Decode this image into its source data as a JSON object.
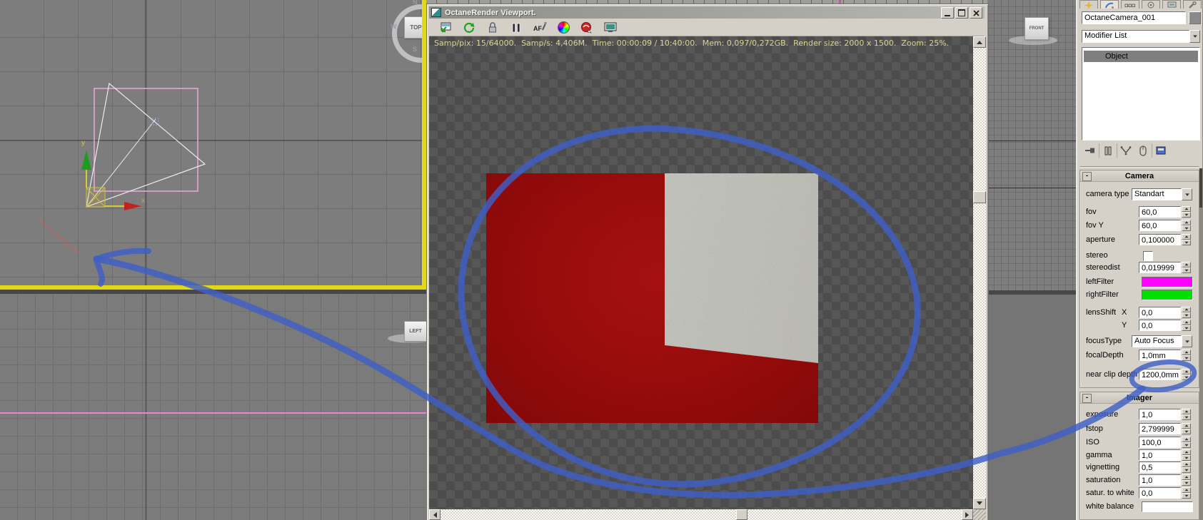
{
  "octane_window": {
    "title": "OctaneRender Viewport.",
    "window_buttons": [
      "minimize",
      "maximize",
      "close"
    ],
    "toolbar_icons": [
      "save-image",
      "restart-render",
      "lock-resolution",
      "pause-render",
      "autofocus-picker",
      "whitebalance-picker",
      "network-render",
      "fit-to-screen"
    ],
    "status_line": "Samp/pix: 15/64000.  Samp/s: 4,406M.  Time: 00:00:09 / 10:40:00.  Mem: 0,097/0,272GB.  Render size: 2000 x 1500.  Zoom: 25%."
  },
  "viewports": {
    "top_view": {
      "viewcube_label": "TOP",
      "compass": {
        "n": "N",
        "w": "W",
        "s": "S"
      },
      "axis_labels": {
        "x": "x",
        "y": "y"
      }
    },
    "left_view": {
      "viewcube_label": "LEFT"
    },
    "front_view": {
      "viewcube_label": "FRONT"
    }
  },
  "command_panel": {
    "tabs": [
      "create",
      "modify",
      "hierarchy",
      "motion",
      "display",
      "utilities"
    ],
    "active_tab": "modify",
    "object_name": "OctaneCamera_001",
    "object_color": "#8a8a8a",
    "modifier_list_label": "Modifier List",
    "modifier_stack": [
      "Object"
    ],
    "stack_tools": [
      "pin-stack",
      "show-end-result",
      "make-unique",
      "remove-modifier",
      "configure-modifier-sets"
    ],
    "rollouts": [
      {
        "title": "Camera",
        "collapse_glyph": "-",
        "rows": [
          {
            "label": "camera type",
            "type": "dropdown",
            "value": "Standart"
          },
          {
            "label": "fov",
            "type": "spinner",
            "value": "60,0"
          },
          {
            "label": "fov Y",
            "type": "spinner",
            "value": "60,0"
          },
          {
            "label": "aperture",
            "type": "spinner",
            "value": "0,100000"
          },
          {
            "label": "stereo",
            "type": "checkbox",
            "checked": false
          },
          {
            "label": "stereodist",
            "type": "spinner",
            "value": "0,019999"
          },
          {
            "label": "leftFilter",
            "type": "color",
            "color": "#ff00ff"
          },
          {
            "label": "rightFilter",
            "type": "color",
            "color": "#00e000"
          },
          {
            "label": "lensShift",
            "axis": "X",
            "type": "spinner",
            "value": "0,0"
          },
          {
            "label": "",
            "axis": "Y",
            "type": "spinner",
            "value": "0,0"
          },
          {
            "label": "focusType",
            "type": "dropdown",
            "value": "Auto Focus"
          },
          {
            "label": "focalDepth",
            "type": "spinner",
            "value": "1,0mm"
          },
          {
            "label": "near clip depth",
            "type": "spinner",
            "value": "1200,0mm"
          }
        ]
      },
      {
        "title": "Imager",
        "collapse_glyph": "-",
        "rows": [
          {
            "label": "exposure",
            "type": "spinner",
            "value": "1,0"
          },
          {
            "label": "fstop",
            "type": "spinner",
            "value": "2,799999"
          },
          {
            "label": "ISO",
            "type": "spinner",
            "value": "100,0"
          },
          {
            "label": "gamma",
            "type": "spinner",
            "value": "1,0"
          },
          {
            "label": "vignetting",
            "type": "spinner",
            "value": "0,5"
          },
          {
            "label": "saturation",
            "type": "spinner",
            "value": "1,0"
          },
          {
            "label": "satur. to white",
            "type": "spinner",
            "value": "0,0"
          },
          {
            "label": "white balance",
            "type": "color",
            "color": "#ffffff"
          }
        ]
      }
    ]
  },
  "annotation": {
    "color": "#3e5fc6",
    "elements": [
      "hand-drawn-circle-around-render",
      "hand-drawn-arrow-to-top-viewport",
      "hand-drawn-circle-around-near-clip-depth",
      "connector-stroke"
    ]
  },
  "colors": {
    "viewport_bg": "#7d7d7d",
    "active_viewport_border": "#e3d912",
    "render_red": "#b80f0f",
    "render_wall_white": "#e9e9e2",
    "selection_pink": "#efa6de",
    "status_text": "#d6d692"
  }
}
